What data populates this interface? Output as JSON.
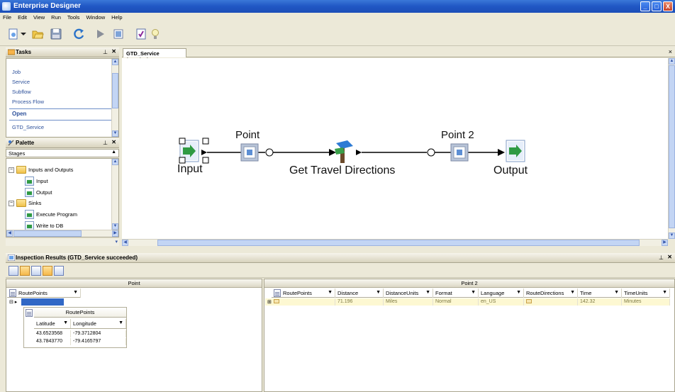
{
  "window": {
    "title": "Enterprise Designer",
    "minimize": "_",
    "maximize": "□",
    "close": "X"
  },
  "menu": [
    "File",
    "Edit",
    "View",
    "Run",
    "Tools",
    "Window",
    "Help"
  ],
  "tasks": {
    "title": "Tasks",
    "pin": "⊥",
    "close": "✕",
    "new_items": [
      "Job",
      "Service",
      "Subflow",
      "Process Flow"
    ],
    "open_heading": "Open",
    "open_items": [
      "GTD_Service"
    ]
  },
  "palette": {
    "title": "Palette",
    "pin": "⊥",
    "close": "✕",
    "filter_value": "Stages",
    "folders": [
      {
        "label": "Inputs and Outputs",
        "expander": "−",
        "items": [
          "Input",
          "Output"
        ]
      },
      {
        "label": "Sinks",
        "expander": "−",
        "items": [
          "Execute Program",
          "Write to DB"
        ]
      }
    ]
  },
  "document": {
    "tab_label": "GTD_Service (Service)",
    "close": "×",
    "nodes": {
      "input": "Input",
      "point": "Point",
      "get_travel_directions": "Get Travel Directions",
      "point2": "Point 2",
      "output": "Output"
    }
  },
  "inspection": {
    "title": "Inspection Results (GTD_Service succeeded)",
    "pin": "⊥",
    "close": "✕",
    "left_pane": {
      "title": "Point",
      "column": "RoutePoints",
      "sub_table": {
        "title": "RoutePoints",
        "columns": [
          "Latitude",
          "Longitude"
        ],
        "rows": [
          [
            "43.6523568",
            "-79.3712804"
          ],
          [
            "43.7843770",
            "-79.4165797"
          ]
        ]
      }
    },
    "right_pane": {
      "title": "Point 2",
      "columns": [
        "RoutePoints",
        "Distance",
        "DistanceUnits",
        "Format",
        "Language",
        "RouteDirections",
        "Time",
        "TimeUnits"
      ],
      "row": [
        "",
        "71.196",
        "Miles",
        "Normal",
        "en_US",
        "",
        "142.32",
        "Minutes"
      ]
    },
    "filter_glyph": "▼"
  }
}
